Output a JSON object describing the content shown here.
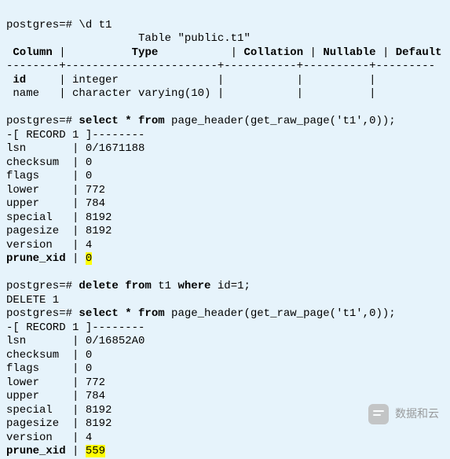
{
  "prompt": "postgres=#",
  "cmd1": "\\d t1",
  "table_title": "Table \"public.t1\"",
  "hdr": {
    "column": "Column",
    "type": "Type",
    "collation": "Collation",
    "nullable": "Nullable",
    "default": "Default"
  },
  "rows": [
    {
      "column": "id",
      "type": "integer"
    },
    {
      "column": "name",
      "type": "character varying(10)"
    }
  ],
  "cmd2_a": "select * from",
  "cmd2_b": " page_header(get_raw_page('t1',0));",
  "rec_marker": "-[ RECORD 1 ]--------",
  "ph1": {
    "lsn": "0/1671188",
    "checksum": "0",
    "flags": "0",
    "lower": "772",
    "upper": "784",
    "special": "8192",
    "pagesize": "8192",
    "version": "4",
    "prune_xid": "0"
  },
  "labels": {
    "lsn": "lsn",
    "checksum": "checksum",
    "flags": "flags",
    "lower": "lower",
    "upper": "upper",
    "special": "special",
    "pagesize": "pagesize",
    "version": "version",
    "prune_xid": "prune_xid"
  },
  "cmd3_a": "delete from",
  "cmd3_b": " t1 ",
  "cmd3_c": "where",
  "cmd3_d": " id",
  "cmd3_e": "=",
  "cmd3_f": "1",
  "cmd3_g": ";",
  "del_result": "DELETE 1",
  "cmd4_a": "select * from",
  "cmd4_b": " page_header(get_raw_page('t1',0));",
  "ph2": {
    "lsn": "0/16852A0",
    "checksum": "0",
    "flags": "0",
    "lower": "772",
    "upper": "784",
    "special": "8192",
    "pagesize": "8192",
    "version": "4",
    "prune_xid": "559"
  },
  "watermark_text": "数据和云"
}
